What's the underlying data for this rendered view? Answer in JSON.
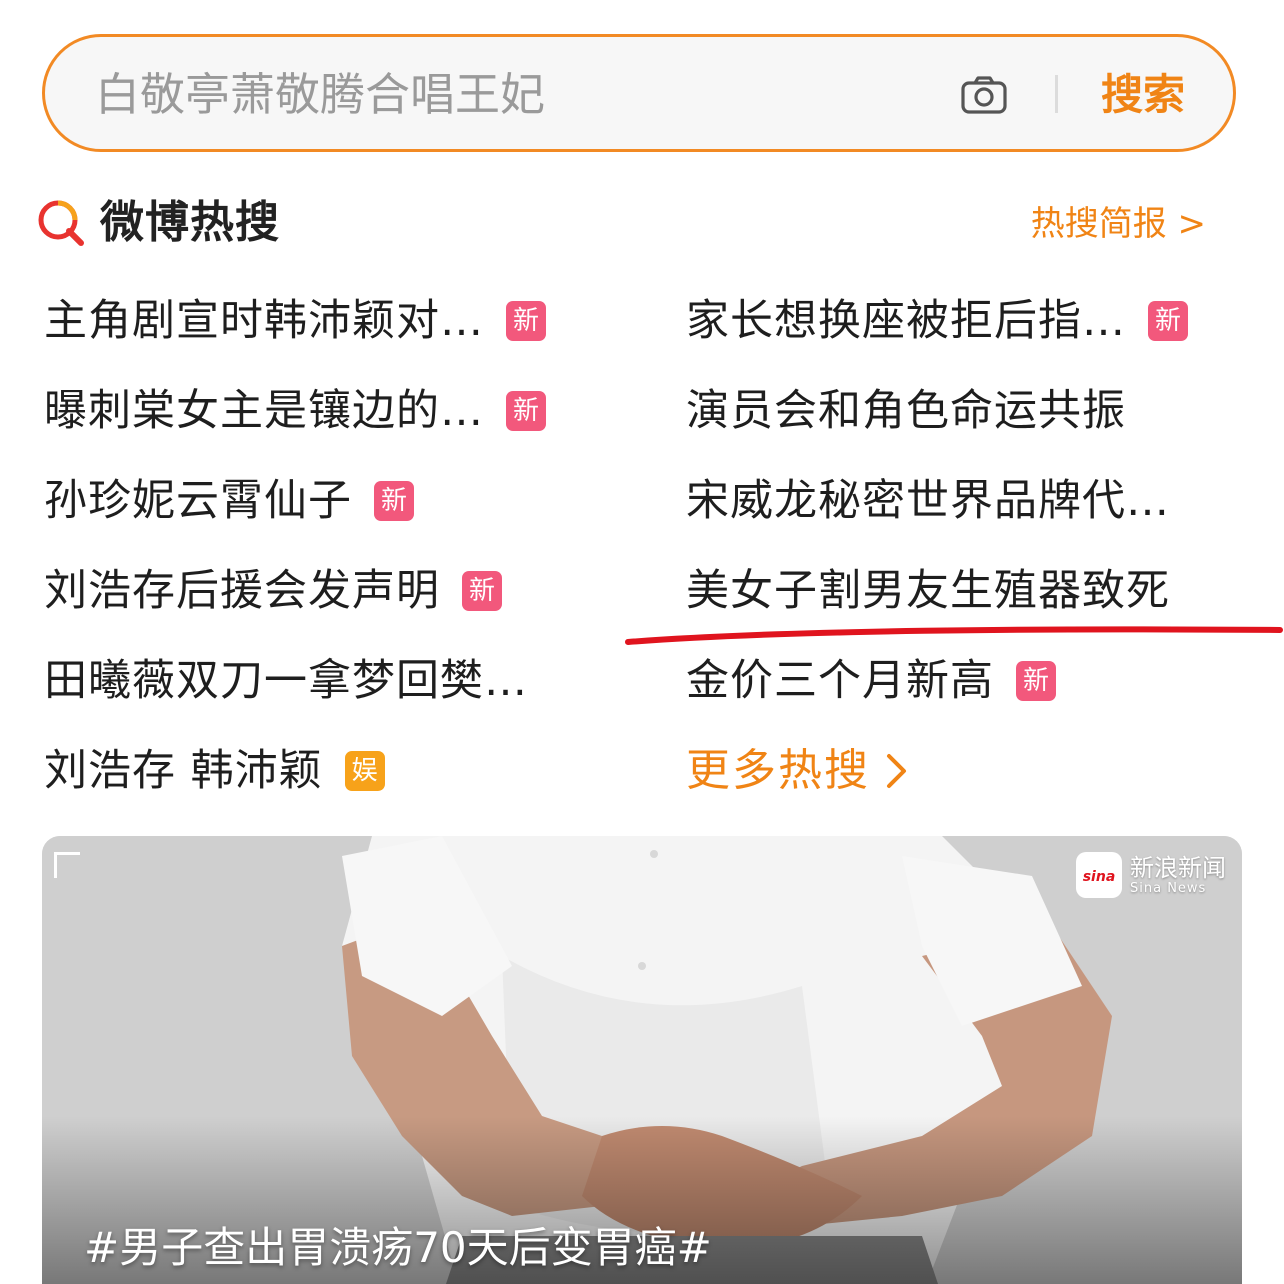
{
  "search": {
    "placeholder": "白敬亭萧敬腾合唱王妃",
    "button_label": "搜索",
    "accent_color": "#f28a24"
  },
  "hot_header": {
    "title": "微博热搜",
    "brief_link": "热搜简报 >"
  },
  "trends_left": [
    {
      "text": "主角剧宣时韩沛颖对…",
      "badge": "新"
    },
    {
      "text": "曝刺棠女主是镶边的…",
      "badge": "新"
    },
    {
      "text": "孙珍妮云霄仙子",
      "badge": "新"
    },
    {
      "text": "刘浩存后援会发声明",
      "badge": "新"
    },
    {
      "text": "田曦薇双刀一拿梦回樊…",
      "badge": ""
    },
    {
      "text": "刘浩存 韩沛颖",
      "badge": "娱"
    }
  ],
  "trends_right": [
    {
      "text": "家长想换座被拒后指…",
      "badge": "新"
    },
    {
      "text": "演员会和角色命运共振",
      "badge": ""
    },
    {
      "text": "宋威龙秘密世界品牌代…",
      "badge": ""
    },
    {
      "text": "美女子割男友生殖器致死",
      "badge": ""
    },
    {
      "text": "金价三个月新高",
      "badge": "新"
    }
  ],
  "more_link": {
    "label": "更多热搜"
  },
  "card": {
    "source_logo_cn": "新浪新闻",
    "source_logo_en": "Sina News",
    "sina_mark": "sina",
    "caption": "#男子查出胃溃疡70天后变胃癌#"
  },
  "colors": {
    "orange": "#f08415",
    "badge_new": "#f2587c",
    "badge_ent": "#f7a21a",
    "underline_red": "#e0141e"
  },
  "icons": {
    "camera": "camera-icon",
    "hot_search_logo": "hot-search-logo-icon",
    "chevron": "chevron-right-icon"
  }
}
